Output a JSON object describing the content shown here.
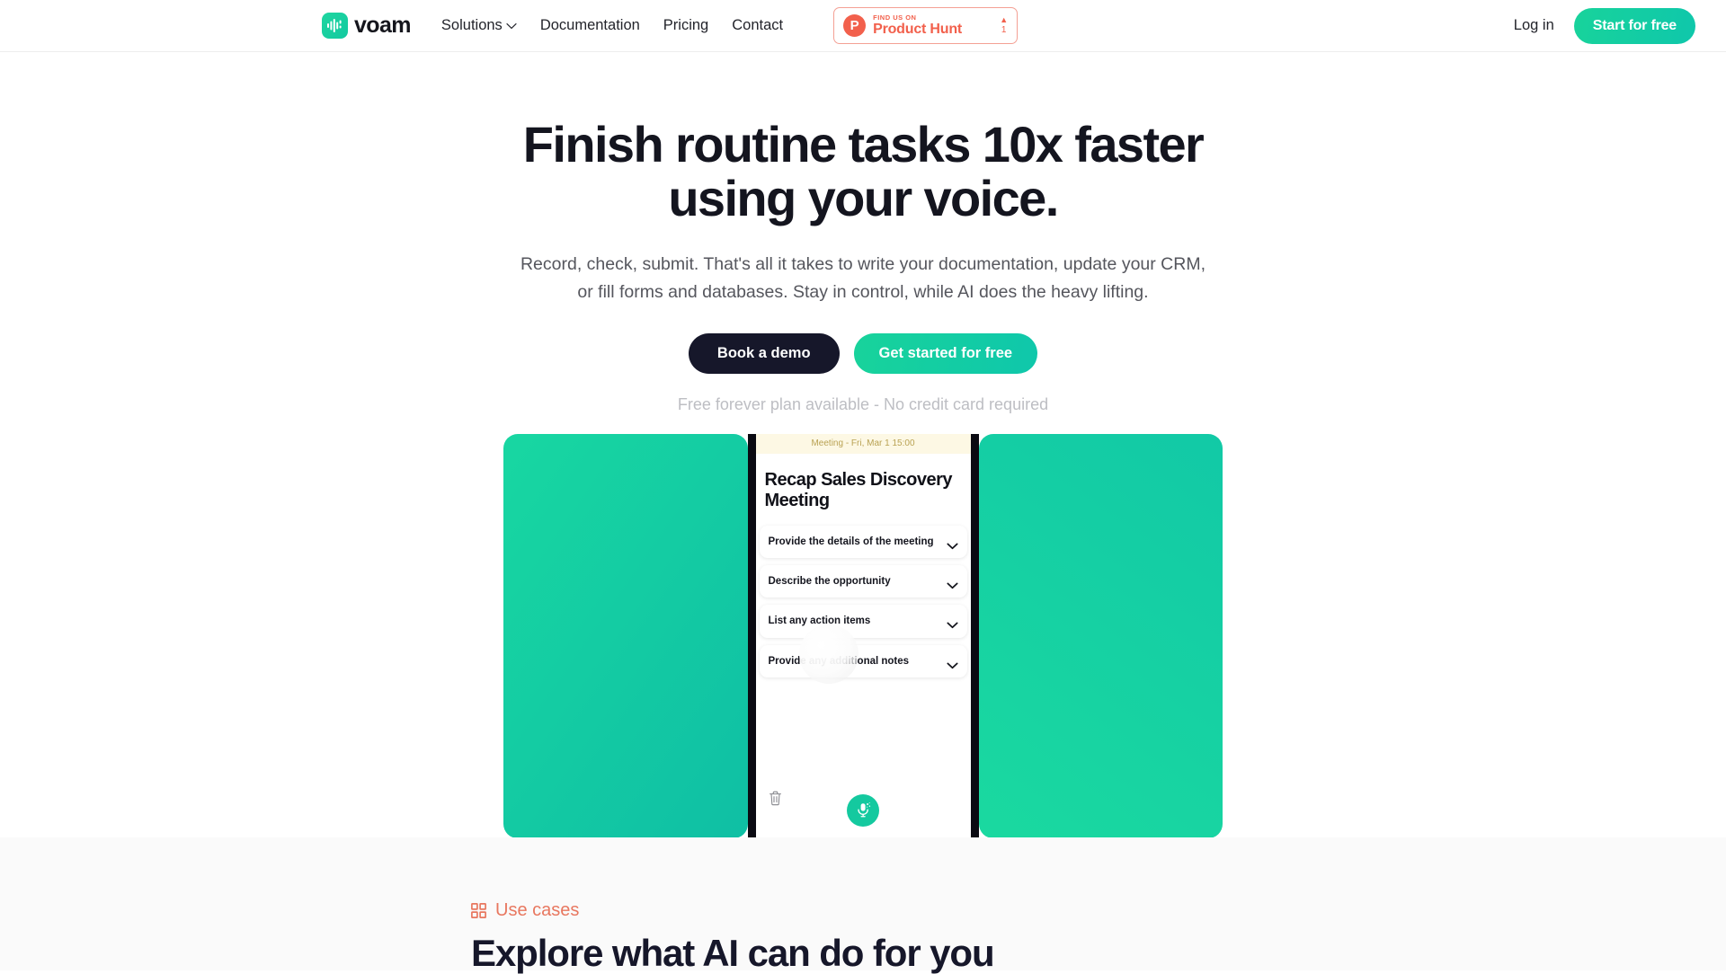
{
  "header": {
    "logo_text": "voam",
    "logo_icon": "voam-waveform-logo",
    "nav": [
      {
        "label": "Solutions",
        "has_dropdown": true,
        "icon": "chevron-down-icon"
      },
      {
        "label": "Documentation",
        "has_dropdown": false
      },
      {
        "label": "Pricing",
        "has_dropdown": false
      },
      {
        "label": "Contact",
        "has_dropdown": false
      }
    ],
    "product_hunt": {
      "icon": "product-hunt-logo-icon",
      "letter": "P",
      "eyebrow": "FIND US ON",
      "name": "Product Hunt",
      "upvote_arrow": "▲",
      "upvote_count": "1",
      "accent_color": "#f2604c"
    },
    "login_label": "Log in",
    "start_label": "Start for free",
    "accent_color": "#18d39b"
  },
  "hero": {
    "title": "Finish routine tasks 10x faster using your voice.",
    "subtitle": "Record, check, submit. That's all it takes to write your documentation, update your CRM, or fill forms and databases. Stay in control, while AI does the heavy lifting.",
    "cta_primary": "Book a demo",
    "cta_secondary": "Get started for free",
    "note": "Free forever plan available - No credit card required"
  },
  "showcase": {
    "panel_color": "#14cfa2",
    "phone": {
      "meeting_banner": "Meeting - Fri, Mar 1 15:00",
      "title": "Recap Sales Discovery Meeting",
      "accordion_items": [
        {
          "label": "Provide the details of the meeting",
          "icon": "chevron-down-icon"
        },
        {
          "label": "Describe the opportunity",
          "icon": "chevron-down-icon"
        },
        {
          "label": "List any action items",
          "icon": "chevron-down-icon"
        },
        {
          "label": "Provide any additional notes",
          "icon": "chevron-down-icon"
        }
      ],
      "delete_icon": "trash-icon",
      "record_icon": "microphone-icon",
      "record_color": "#14c99f"
    }
  },
  "use_cases": {
    "eyebrow": "Use cases",
    "eyebrow_icon": "grid-squares-icon",
    "eyebrow_color": "#e8775f",
    "heading": "Explore what AI can do for you"
  }
}
